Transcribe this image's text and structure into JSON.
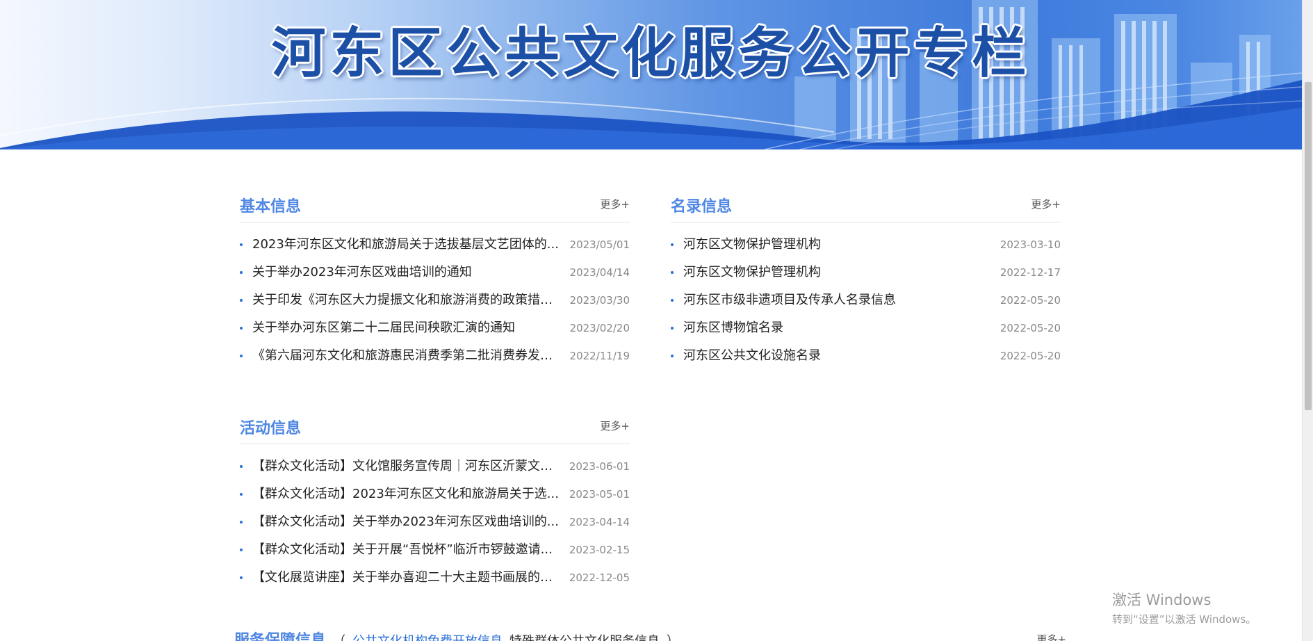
{
  "banner": {
    "title": "河东区公共文化服务公开专栏"
  },
  "sections": {
    "basic": {
      "title": "基本信息",
      "more": "更多+",
      "items": [
        {
          "text": "2023年河东区文化和旅游局关于选拔基层文艺团体的...",
          "date": "2023/05/01"
        },
        {
          "text": "关于举办2023年河东区戏曲培训的通知",
          "date": "2023/04/14"
        },
        {
          "text": "关于印发《河东区大力提振文化和旅游消费的政策措施...",
          "date": "2023/03/30"
        },
        {
          "text": "关于举办河东区第二十二届民间秧歌汇演的通知",
          "date": "2023/02/20"
        },
        {
          "text": "《第六届河东文化和旅游惠民消费季第二批消费券发放...",
          "date": "2022/11/19"
        }
      ]
    },
    "directory": {
      "title": "名录信息",
      "more": "更多+",
      "items": [
        {
          "text": "河东区文物保护管理机构",
          "date": "2023-03-10"
        },
        {
          "text": "河东区文物保护管理机构",
          "date": "2022-12-17"
        },
        {
          "text": "河东区市级非遗项目及传承人名录信息",
          "date": "2022-05-20"
        },
        {
          "text": "河东区博物馆名录",
          "date": "2022-05-20"
        },
        {
          "text": "河东区公共文化设施名录",
          "date": "2022-05-20"
        }
      ]
    },
    "activity": {
      "title": "活动信息",
      "more": "更多+",
      "items": [
        {
          "text": "【群众文化活动】文化馆服务宣传周｜河东区沂蒙文艺...",
          "date": "2023-06-01"
        },
        {
          "text": "【群众文化活动】2023年河东区文化和旅游局关于选...",
          "date": "2023-05-01"
        },
        {
          "text": "【群众文化活动】关于举办2023年河东区戏曲培训的...",
          "date": "2023-04-14"
        },
        {
          "text": "【群众文化活动】关于开展“吾悦杯”临沂市锣鼓邀请...",
          "date": "2023-02-15"
        },
        {
          "text": "【文化展览讲座】关于举办喜迎二十大主题书画展的通...",
          "date": "2022-12-05"
        }
      ]
    }
  },
  "service": {
    "title": "服务保障信息",
    "tab_open": "（",
    "tab1": "公共文化机构免费开放信息",
    "tab2": "特殊群体公共文化服务信息",
    "tab_close": "）",
    "more": "更多+"
  },
  "watermark": {
    "line1": "激活 Windows",
    "line2": "转到“设置”以激活 Windows。"
  },
  "colors": {
    "accent": "#4f87e3",
    "link_blue": "#2a6fd6",
    "date_gray": "#888888"
  }
}
